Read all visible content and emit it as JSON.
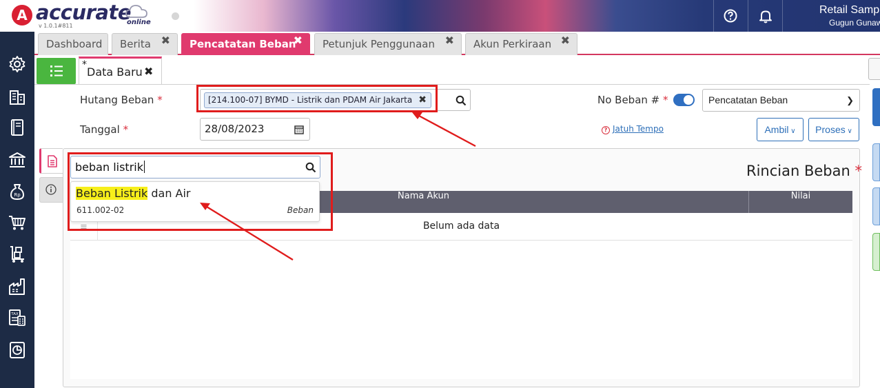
{
  "header": {
    "logo_badge": "A",
    "logo_text": "accurate",
    "logo_sub": "online",
    "version": "v 1.0.1#811",
    "help_icon": "question-circle-icon",
    "bell_icon": "bell-icon",
    "company": "Retail Samp",
    "user": "Gugun Gunaw"
  },
  "sidebar": {
    "icons": [
      "gear-icon",
      "building-icon",
      "book-icon",
      "bank-icon",
      "money-bag-icon",
      "cart-icon",
      "trolley-boxes-icon",
      "factory-icon",
      "tax-icon",
      "report-icon"
    ]
  },
  "tabs": [
    {
      "label": "Dashboard",
      "closable": false
    },
    {
      "label": "Berita",
      "closable": true
    },
    {
      "label": "Pencatatan Beban",
      "closable": true,
      "active": true
    },
    {
      "label": "Petunjuk Penggunaan",
      "closable": true
    },
    {
      "label": "Akun Perkiraan",
      "closable": true
    }
  ],
  "subtab": {
    "star": "*",
    "label": "Data Baru",
    "close": "✖"
  },
  "form": {
    "hutang_label": "Hutang Beban",
    "required_mark": "*",
    "hutang_value": "[214.100-07] BYMD - Listrik dan PDAM Air Jakarta",
    "tanggal_label": "Tanggal",
    "tanggal_value": "28/08/2023",
    "no_beban_label": "No Beban #",
    "no_beban_select": "Pencatatan Beban",
    "jatuh_tempo": "Jatuh Tempo",
    "ambil": "Ambil",
    "proses": "Proses"
  },
  "detail": {
    "title": "Rincian Beban",
    "required_mark": "*",
    "search_value": "beban listrik",
    "columns": [
      "Nama Akun",
      "Nilai"
    ],
    "empty_text": "Belum ada data",
    "handle": "≡",
    "result": {
      "highlight": "Beban Listrik",
      "rest": " dan Air",
      "code": "611.002-02",
      "type": "Beban"
    }
  },
  "colors": {
    "accent_pink": "#e03a6e",
    "sidebar": "#1d2b45",
    "list_button": "#4ab63f",
    "annotation": "#e01c1c",
    "highlight": "#f7ef1a"
  }
}
